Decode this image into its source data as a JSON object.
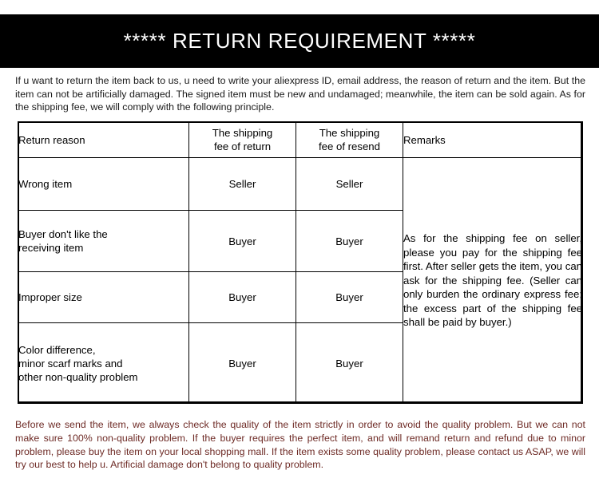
{
  "banner": {
    "title": "***** RETURN REQUIREMENT *****"
  },
  "intro": {
    "text": "If u want to return the item back to us, u need to write your aliexpress ID, email address, the reason of return and the item. But the item can not be artificially damaged. The signed item must be new and undamaged; meanwhile, the item can be sold again. As for the shipping fee, we will comply with the following principle."
  },
  "table": {
    "headers": {
      "reason": "Return reason",
      "shipping_return": "The shipping\nfee of return",
      "shipping_resend": "The shipping\nfee of resend",
      "remarks": "Remarks"
    },
    "rows": [
      {
        "reason": "Wrong item",
        "fee_return": "Seller",
        "fee_resend": "Seller"
      },
      {
        "reason": "Buyer don't like the\nreceiving item",
        "fee_return": "Buyer",
        "fee_resend": "Buyer"
      },
      {
        "reason": "Improper size",
        "fee_return": "Buyer",
        "fee_resend": "Buyer"
      },
      {
        "reason": "Color difference,\nminor scarf marks and\nother non-quality problem",
        "fee_return": "Buyer",
        "fee_resend": "Buyer"
      }
    ],
    "remarks_body": "As for the shipping fee on seller, please you pay for the shipping fee first. After seller gets the item, you can ask for the shipping fee. (Seller can only burden the ordinary express fee; the excess part of the shipping fee shall be paid by buyer.)"
  },
  "footer": {
    "text": "Before we send the item, we always check the quality of the item strictly in order to avoid the quality problem. But we can not make sure 100% non-quality problem. If the buyer requires the perfect item, and will remand return and refund due to minor problem, please buy the item on your local shopping mall. If the item exists some quality problem, please contact us ASAP, we will try our best to help u. Artificial damage don't belong to quality problem."
  },
  "colors": {
    "banner_background": "#000000",
    "banner_text": "#ffffff",
    "body_text": "#000000",
    "footer_text": "#6e2b26",
    "table_border": "#000000",
    "page_background": "#ffffff"
  }
}
